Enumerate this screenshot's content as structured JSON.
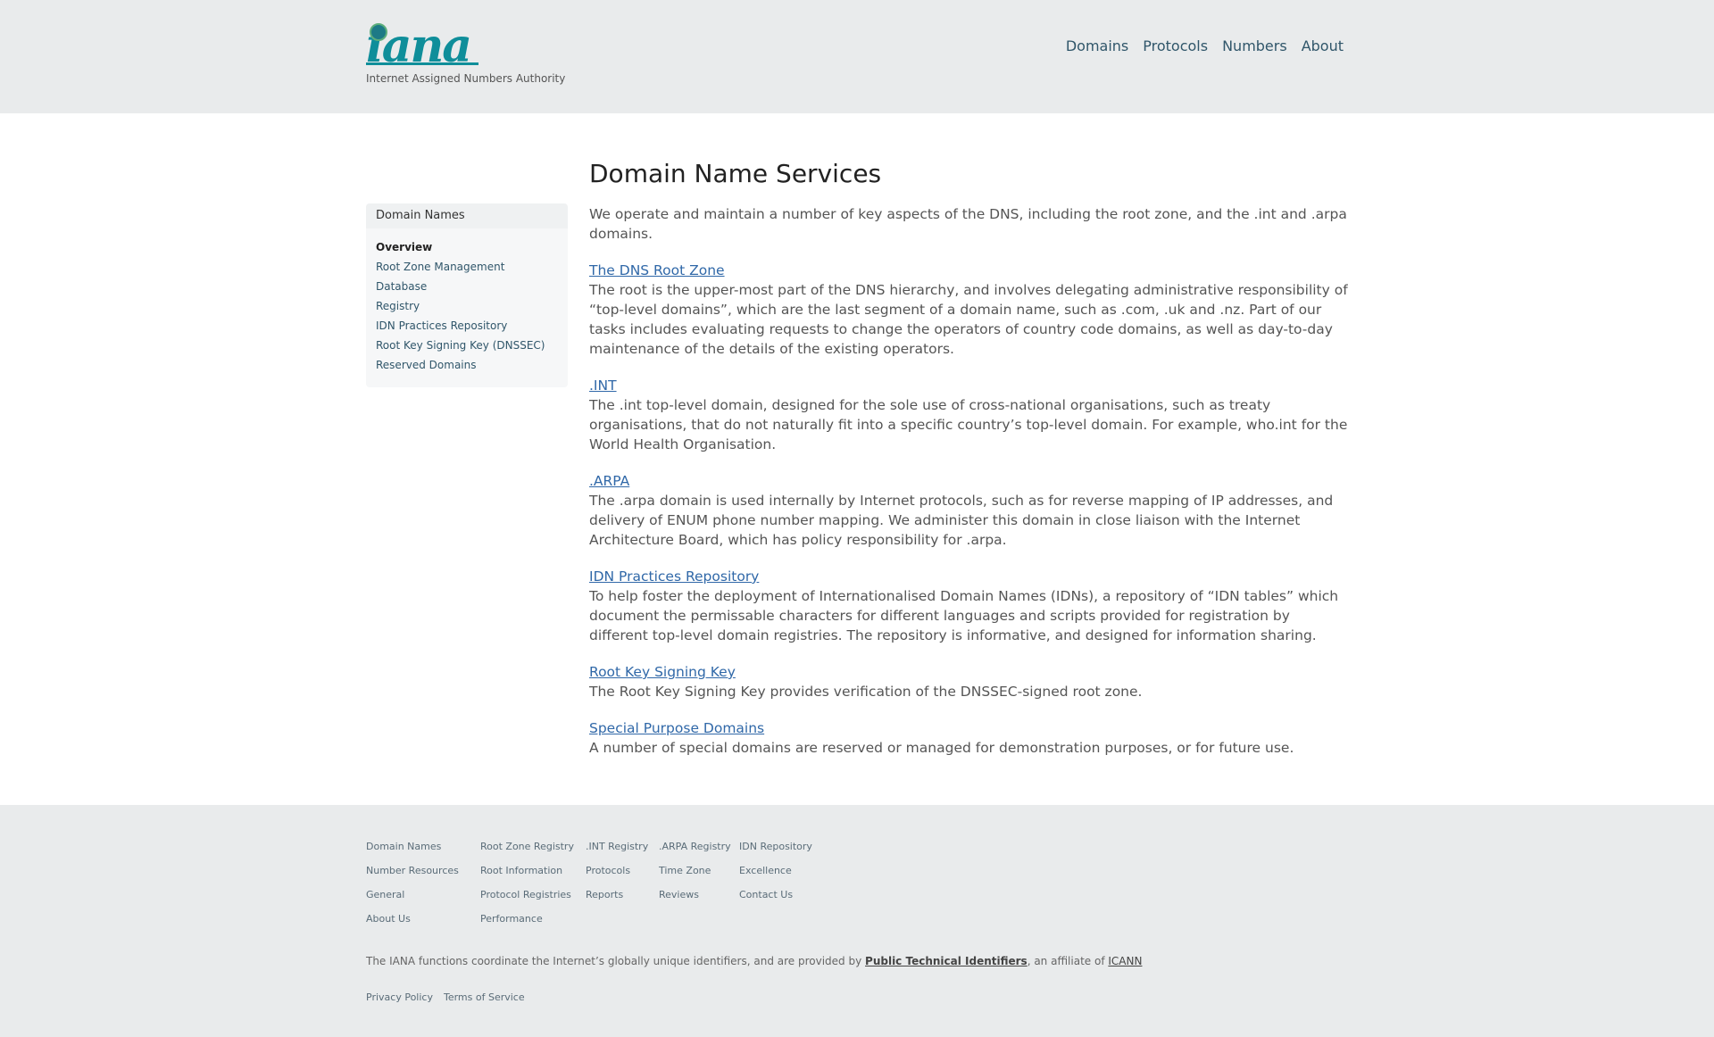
{
  "header": {
    "logo_text": "iana",
    "tagline": "Internet Assigned Numbers Authority",
    "nav": [
      "Domains",
      "Protocols",
      "Numbers",
      "About"
    ]
  },
  "sidebar": {
    "title": "Domain Names",
    "items": [
      "Overview",
      "Root Zone Management",
      "Database",
      "Registry",
      "IDN Practices Repository",
      "Root Key Signing Key (DNSSEC)",
      "Reserved Domains"
    ]
  },
  "main": {
    "title": "Domain Name Services",
    "intro": "We operate and maintain a number of key aspects of the DNS, including the root zone, and the .int and .arpa domains.",
    "sections": [
      {
        "heading": "The DNS Root Zone",
        "body": "The root is the upper-most part of the DNS hierarchy, and involves delegating administrative responsibility of “top-level domains”, which are the last segment of a domain name, such as .com, .uk and .nz. Part of our tasks includes evaluating requests to change the operators of country code domains, as well as day-to-day maintenance of the details of the existing operators."
      },
      {
        "heading": ".INT",
        "body": "The .int top-level domain, designed for the sole use of cross-national organisations, such as treaty organisations, that do not naturally fit into a specific country’s top-level domain. For example, who.int for the World Health Organisation."
      },
      {
        "heading": ".ARPA",
        "body": "The .arpa domain is used internally by Internet protocols, such as for reverse mapping of IP addresses, and delivery of ENUM phone number mapping. We administer this domain in close liaison with the Internet Architecture Board, which has policy responsibility for .arpa."
      },
      {
        "heading": "IDN Practices Repository",
        "body": "To help foster the deployment of Internationalised Domain Names (IDNs), a repository of “IDN tables” which document the permissable characters for different languages and scripts provided for registration by different top-level domain registries. The repository is informative, and designed for information sharing."
      },
      {
        "heading": "Root Key Signing Key",
        "body": "The Root Key Signing Key provides verification of the DNSSEC-signed root zone."
      },
      {
        "heading": "Special Purpose Domains",
        "body": "A number of special domains are reserved or managed for demonstration purposes, or for future use."
      }
    ]
  },
  "footer": {
    "columns": [
      [
        "Domain Names",
        "Number Resources",
        "General",
        "About Us"
      ],
      [
        "Root Zone Registry",
        "Root Information",
        "Protocol Registries",
        "Performance"
      ],
      [
        ".INT Registry",
        "Protocols",
        "Reports"
      ],
      [
        ".ARPA Registry",
        "Time Zone",
        "Reviews"
      ],
      [
        "IDN Repository",
        "Excellence",
        "Contact Us"
      ]
    ],
    "text_prefix": "The IANA functions coordinate the Internet’s globally unique identifiers, and are provided by",
    "pti_link": "Public Technical Identifiers",
    "text_mid": ", an affiliate of",
    "icann_link": "ICANN",
    "legal": [
      "Privacy Policy",
      "Terms of Service"
    ]
  }
}
